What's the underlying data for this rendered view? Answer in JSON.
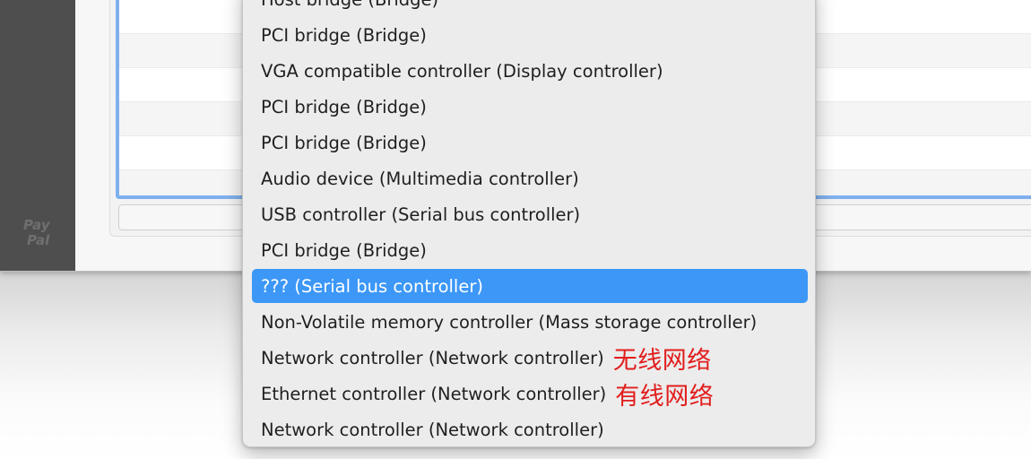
{
  "sidebar": {
    "logo_text": [
      "Pay",
      "Pal"
    ]
  },
  "device_list": {
    "row_count": 6
  },
  "popup_menu": {
    "items": [
      {
        "label": "Host bridge (Bridge)",
        "selected": false,
        "note": ""
      },
      {
        "label": "PCI bridge (Bridge)",
        "selected": false,
        "note": ""
      },
      {
        "label": "VGA compatible controller (Display controller)",
        "selected": false,
        "note": ""
      },
      {
        "label": "PCI bridge (Bridge)",
        "selected": false,
        "note": ""
      },
      {
        "label": "PCI bridge (Bridge)",
        "selected": false,
        "note": ""
      },
      {
        "label": "Audio device (Multimedia controller)",
        "selected": false,
        "note": ""
      },
      {
        "label": "USB controller (Serial bus controller)",
        "selected": false,
        "note": ""
      },
      {
        "label": "PCI bridge (Bridge)",
        "selected": false,
        "note": ""
      },
      {
        "label": "??? (Serial bus controller)",
        "selected": true,
        "note": ""
      },
      {
        "label": "Non-Volatile memory controller (Mass storage controller)",
        "selected": false,
        "note": ""
      },
      {
        "label": "Network controller (Network controller)",
        "selected": false,
        "note": "无线网络"
      },
      {
        "label": "Ethernet controller (Network controller)",
        "selected": false,
        "note": "有线网络"
      },
      {
        "label": "Network controller (Network controller)",
        "selected": false,
        "note": ""
      }
    ]
  },
  "colors": {
    "selection": "#3c97f7",
    "annotation": "#e21d1d",
    "list_focus_ring": "#7fb0ee",
    "sidebar": "#4e4e4e"
  }
}
